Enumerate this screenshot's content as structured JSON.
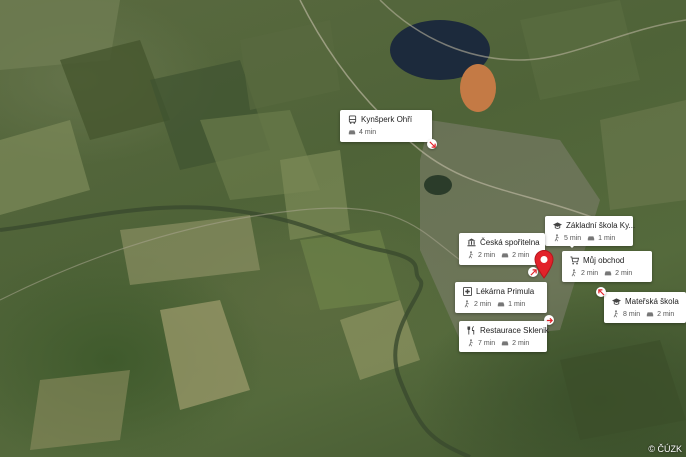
{
  "map": {
    "attribution": "© ČÚZK",
    "accent_color": "#e2222a"
  },
  "pois": [
    {
      "id": "kynsperk",
      "icon": "bus-icon",
      "title": "Kynšperk Ohří",
      "meta": [
        {
          "icon": "car-icon",
          "text": "4 min"
        }
      ]
    },
    {
      "id": "zs",
      "icon": "school-icon",
      "title": "Základní škola Ky...",
      "meta": [
        {
          "icon": "walk-icon",
          "text": "5 min"
        },
        {
          "icon": "car-icon",
          "text": "1 min"
        }
      ]
    },
    {
      "id": "csas",
      "icon": "bank-icon",
      "title": "Česká spořitelna",
      "meta": [
        {
          "icon": "walk-icon",
          "text": "2 min"
        },
        {
          "icon": "car-icon",
          "text": "2 min"
        }
      ]
    },
    {
      "id": "obchod",
      "icon": "cart-icon",
      "title": "Můj obchod",
      "meta": [
        {
          "icon": "walk-icon",
          "text": "2 min"
        },
        {
          "icon": "car-icon",
          "text": "2 min"
        }
      ]
    },
    {
      "id": "lekarna",
      "icon": "pharmacy-icon",
      "title": "Lékárna Primula",
      "meta": [
        {
          "icon": "walk-icon",
          "text": "2 min"
        },
        {
          "icon": "car-icon",
          "text": "1 min"
        }
      ]
    },
    {
      "id": "ms",
      "icon": "school-icon",
      "title": "Mateřská škola",
      "meta": [
        {
          "icon": "walk-icon",
          "text": "8 min"
        },
        {
          "icon": "car-icon",
          "text": "2 min"
        }
      ]
    },
    {
      "id": "restaurace",
      "icon": "restaurant-icon",
      "title": "Restaurace Sklenik",
      "meta": [
        {
          "icon": "walk-icon",
          "text": "7 min"
        },
        {
          "icon": "car-icon",
          "text": "2 min"
        }
      ]
    }
  ]
}
